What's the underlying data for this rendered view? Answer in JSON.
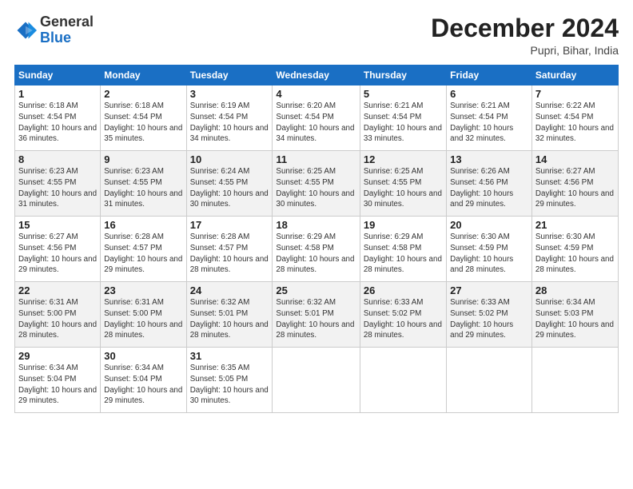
{
  "logo": {
    "general": "General",
    "blue": "Blue"
  },
  "header": {
    "month": "December 2024",
    "location": "Pupri, Bihar, India"
  },
  "weekdays": [
    "Sunday",
    "Monday",
    "Tuesday",
    "Wednesday",
    "Thursday",
    "Friday",
    "Saturday"
  ],
  "weeks": [
    [
      {
        "day": "1",
        "sunrise": "6:18 AM",
        "sunset": "4:54 PM",
        "daylight": "10 hours and 36 minutes."
      },
      {
        "day": "2",
        "sunrise": "6:18 AM",
        "sunset": "4:54 PM",
        "daylight": "10 hours and 35 minutes."
      },
      {
        "day": "3",
        "sunrise": "6:19 AM",
        "sunset": "4:54 PM",
        "daylight": "10 hours and 34 minutes."
      },
      {
        "day": "4",
        "sunrise": "6:20 AM",
        "sunset": "4:54 PM",
        "daylight": "10 hours and 34 minutes."
      },
      {
        "day": "5",
        "sunrise": "6:21 AM",
        "sunset": "4:54 PM",
        "daylight": "10 hours and 33 minutes."
      },
      {
        "day": "6",
        "sunrise": "6:21 AM",
        "sunset": "4:54 PM",
        "daylight": "10 hours and 32 minutes."
      },
      {
        "day": "7",
        "sunrise": "6:22 AM",
        "sunset": "4:54 PM",
        "daylight": "10 hours and 32 minutes."
      }
    ],
    [
      {
        "day": "8",
        "sunrise": "6:23 AM",
        "sunset": "4:55 PM",
        "daylight": "10 hours and 31 minutes."
      },
      {
        "day": "9",
        "sunrise": "6:23 AM",
        "sunset": "4:55 PM",
        "daylight": "10 hours and 31 minutes."
      },
      {
        "day": "10",
        "sunrise": "6:24 AM",
        "sunset": "4:55 PM",
        "daylight": "10 hours and 30 minutes."
      },
      {
        "day": "11",
        "sunrise": "6:25 AM",
        "sunset": "4:55 PM",
        "daylight": "10 hours and 30 minutes."
      },
      {
        "day": "12",
        "sunrise": "6:25 AM",
        "sunset": "4:55 PM",
        "daylight": "10 hours and 30 minutes."
      },
      {
        "day": "13",
        "sunrise": "6:26 AM",
        "sunset": "4:56 PM",
        "daylight": "10 hours and 29 minutes."
      },
      {
        "day": "14",
        "sunrise": "6:27 AM",
        "sunset": "4:56 PM",
        "daylight": "10 hours and 29 minutes."
      }
    ],
    [
      {
        "day": "15",
        "sunrise": "6:27 AM",
        "sunset": "4:56 PM",
        "daylight": "10 hours and 29 minutes."
      },
      {
        "day": "16",
        "sunrise": "6:28 AM",
        "sunset": "4:57 PM",
        "daylight": "10 hours and 29 minutes."
      },
      {
        "day": "17",
        "sunrise": "6:28 AM",
        "sunset": "4:57 PM",
        "daylight": "10 hours and 28 minutes."
      },
      {
        "day": "18",
        "sunrise": "6:29 AM",
        "sunset": "4:58 PM",
        "daylight": "10 hours and 28 minutes."
      },
      {
        "day": "19",
        "sunrise": "6:29 AM",
        "sunset": "4:58 PM",
        "daylight": "10 hours and 28 minutes."
      },
      {
        "day": "20",
        "sunrise": "6:30 AM",
        "sunset": "4:59 PM",
        "daylight": "10 hours and 28 minutes."
      },
      {
        "day": "21",
        "sunrise": "6:30 AM",
        "sunset": "4:59 PM",
        "daylight": "10 hours and 28 minutes."
      }
    ],
    [
      {
        "day": "22",
        "sunrise": "6:31 AM",
        "sunset": "5:00 PM",
        "daylight": "10 hours and 28 minutes."
      },
      {
        "day": "23",
        "sunrise": "6:31 AM",
        "sunset": "5:00 PM",
        "daylight": "10 hours and 28 minutes."
      },
      {
        "day": "24",
        "sunrise": "6:32 AM",
        "sunset": "5:01 PM",
        "daylight": "10 hours and 28 minutes."
      },
      {
        "day": "25",
        "sunrise": "6:32 AM",
        "sunset": "5:01 PM",
        "daylight": "10 hours and 28 minutes."
      },
      {
        "day": "26",
        "sunrise": "6:33 AM",
        "sunset": "5:02 PM",
        "daylight": "10 hours and 28 minutes."
      },
      {
        "day": "27",
        "sunrise": "6:33 AM",
        "sunset": "5:02 PM",
        "daylight": "10 hours and 29 minutes."
      },
      {
        "day": "28",
        "sunrise": "6:34 AM",
        "sunset": "5:03 PM",
        "daylight": "10 hours and 29 minutes."
      }
    ],
    [
      {
        "day": "29",
        "sunrise": "6:34 AM",
        "sunset": "5:04 PM",
        "daylight": "10 hours and 29 minutes."
      },
      {
        "day": "30",
        "sunrise": "6:34 AM",
        "sunset": "5:04 PM",
        "daylight": "10 hours and 29 minutes."
      },
      {
        "day": "31",
        "sunrise": "6:35 AM",
        "sunset": "5:05 PM",
        "daylight": "10 hours and 30 minutes."
      },
      null,
      null,
      null,
      null
    ]
  ]
}
